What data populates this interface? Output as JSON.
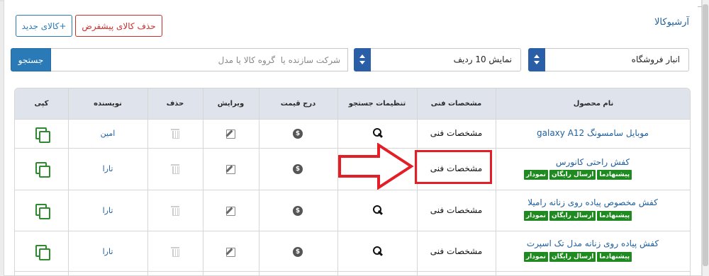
{
  "header": {
    "title": "آرشیوکالا",
    "new_button": "+کالای جدید",
    "delete_button": "حذف کالای پیشفرض"
  },
  "filters": {
    "search_button": "جستجو",
    "search_placeholder": "شرکت سازنده یا  گروه کالا یا مدل",
    "rows_select": "نمایش 10 ردیف",
    "store_select": "انبار فروشگاه"
  },
  "table": {
    "headers": {
      "name": "نام محصول",
      "specs": "مشخصات فنی",
      "search_settings": "تنظیمات جستجو",
      "price": "درج قیمت",
      "edit": "ویرایش",
      "delete": "حذف",
      "author": "نویسنده",
      "copy": "کپی"
    },
    "rows": [
      {
        "name": "موبایل سامسونگ galaxy A12",
        "specs": "مشخصات فنی",
        "author": "امین",
        "tags": []
      },
      {
        "name": "کفش راحتی کانورس",
        "specs": "مشخصات فنی",
        "author": "تارا",
        "tags": [
          "پیشنهادما",
          "ارسال رایگان",
          "نمودار"
        ]
      },
      {
        "name": "کفش مخصوص پیاده روی زنانه راميلا",
        "specs": "مشخصات فنی",
        "author": "تارا",
        "tags": [
          "پیشنهادما",
          "ارسال رایگان",
          "نمودار"
        ]
      },
      {
        "name": "کفش پیاده روی زنانه مدل تک اسپرت",
        "specs": "مشخصات فنی",
        "author": "تارا",
        "tags": [
          "پیشنهادما",
          "ارسال رایگان",
          "نمودار"
        ]
      }
    ]
  },
  "icons": {
    "copy": "copy-icon",
    "delete": "trash-icon",
    "edit": "edit-icon",
    "price": "dollar-coin-icon",
    "search": "search-icon"
  },
  "colors": {
    "accent": "#2a7ab8",
    "danger": "#c9302c",
    "tag": "#1f8a1f",
    "annotation": "#e41e26",
    "header_bg": "#dfe4ec"
  }
}
